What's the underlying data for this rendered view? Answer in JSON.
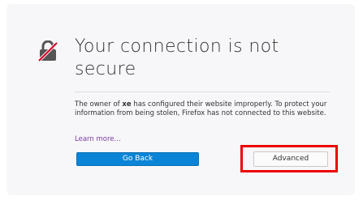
{
  "error_page": {
    "title": "Your connection is not secure",
    "description_prefix": "The owner of ",
    "site_name": "xe",
    "description_suffix": " has configured their website improperly. To protect your information from being stolen, Firefox has not connected to this website.",
    "learn_more_label": "Learn more…",
    "go_back_label": "Go Back",
    "advanced_label": "Advanced"
  },
  "icons": {
    "lock": "broken-lock-icon"
  },
  "colors": {
    "page_background": "#f7f7f9",
    "link": "#7a3a9e",
    "primary_button": "#0a84d6",
    "highlight": "#ee0000",
    "slash": "#d70022"
  }
}
